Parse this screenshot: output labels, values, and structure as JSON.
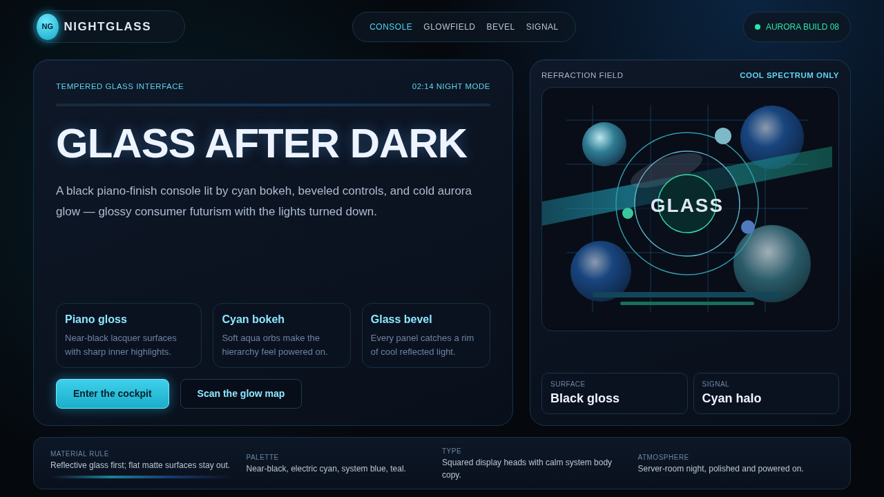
{
  "brand": {
    "badge": "NG",
    "name": "NIGHTGLASS"
  },
  "nav": [
    {
      "label": "CONSOLE",
      "selected": true
    },
    {
      "label": "GLOWFIELD",
      "selected": false
    },
    {
      "label": "BEVEL",
      "selected": false
    },
    {
      "label": "SIGNAL",
      "selected": false
    }
  ],
  "status": {
    "label": "AURORA BUILD 08",
    "color": "#2ee6a6"
  },
  "hero": {
    "eyebrow": "TEMPERED GLASS INTERFACE",
    "time": "02:14 NIGHT MODE",
    "title": "GLASS AFTER DARK",
    "description": "A black piano-finish console lit by cyan bokeh, beveled controls, and cold aurora glow — glossy consumer futurism with the lights turned down.",
    "features": [
      {
        "title": "Piano gloss",
        "text": "Near-black lacquer surfaces with sharp inner highlights."
      },
      {
        "title": "Cyan bokeh",
        "text": "Soft aqua orbs make the hierarchy feel powered on."
      },
      {
        "title": "Glass bevel",
        "text": "Every panel catches a rim of cool reflected light."
      }
    ],
    "buttons": [
      {
        "label": "Enter the cockpit",
        "kind": "primary"
      },
      {
        "label": "Scan the glow map",
        "kind": "outline"
      }
    ]
  },
  "field": {
    "title": "REFRACTION FIELD",
    "note": "COOL SPECTRUM ONLY",
    "scene_label": "GLASS",
    "stats": [
      {
        "label": "SURFACE",
        "value": "Black gloss"
      },
      {
        "label": "SIGNAL",
        "value": "Cyan halo"
      }
    ]
  },
  "footer": [
    {
      "label": "MATERIAL RULE",
      "text": "Reflective glass first; flat matte surfaces stay out.",
      "highlighted": true
    },
    {
      "label": "PALETTE",
      "text": "Near-black, electric cyan, system blue, teal.",
      "highlighted": false
    },
    {
      "label": "TYPE",
      "text": "Squared display heads with calm system body copy.",
      "highlighted": false
    },
    {
      "label": "ATMOSPHERE",
      "text": "Server-room night, polished and powered on.",
      "highlighted": false
    }
  ]
}
